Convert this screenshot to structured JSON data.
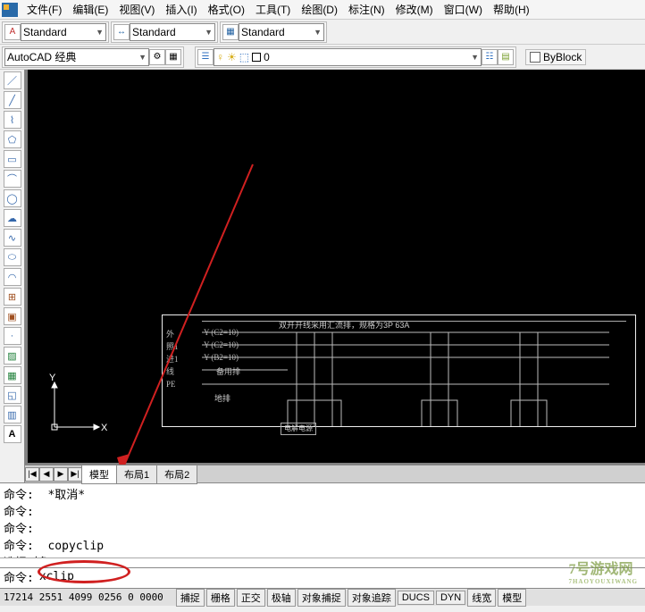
{
  "menu": {
    "items": [
      "文件(F)",
      "编辑(E)",
      "视图(V)",
      "插入(I)",
      "格式(O)",
      "工具(T)",
      "绘图(D)",
      "标注(N)",
      "修改(M)",
      "窗口(W)",
      "帮助(H)"
    ]
  },
  "toolbar1": {
    "style1": "Standard",
    "style2": "Standard",
    "style3": "Standard"
  },
  "toolbar2": {
    "workspace": "AutoCAD 经典",
    "layer": "0",
    "byblock": "ByBlock"
  },
  "tabs": {
    "nav": [
      "|◀",
      "◀",
      "▶",
      "▶|"
    ],
    "items": [
      "模型",
      "布局1",
      "布局2"
    ],
    "active_index": 0
  },
  "ucs": {
    "x": "X",
    "y": "Y"
  },
  "drawing": {
    "note": "双开开线采用汇流排，规格为3P 63A",
    "rows": [
      "外",
      "照1",
      "进1",
      "线",
      "",
      "PE"
    ],
    "annot": [
      "Y   (C2=10)",
      "Y   (C2=10)",
      "Y   (B2=10)",
      "备用排"
    ],
    "gnd": "地排",
    "box1": "电解电源"
  },
  "command": {
    "history": "命令:  *取消*\n命令:\n命令:\n命令:  copyclip\n选择对象:",
    "prompt": "命令:",
    "input_value": "xclip"
  },
  "status": {
    "coords": "17214 2551  4099 0256  0 0000",
    "buttons": [
      "捕捉",
      "栅格",
      "正交",
      "极轴",
      "对象捕捉",
      "对象追踪",
      "DUCS",
      "DYN",
      "线宽",
      "模型"
    ]
  },
  "watermark": {
    "main": "7号游戏网",
    "sub": "7HAOYOUXIWANG"
  }
}
